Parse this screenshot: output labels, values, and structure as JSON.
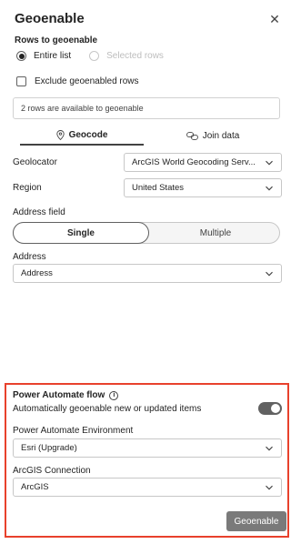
{
  "header": {
    "title": "Geoenable",
    "close_icon": "close-icon"
  },
  "rows_section": {
    "label": "Rows to geoenable",
    "options": [
      {
        "label": "Entire list",
        "checked": true,
        "disabled": false
      },
      {
        "label": "Selected rows",
        "checked": false,
        "disabled": true
      }
    ],
    "exclude_label": "Exclude geoenabled rows",
    "exclude_checked": false,
    "info_text": "2 rows are available to geoenable"
  },
  "tabs": [
    {
      "label": "Geocode",
      "icon": "location-pin-icon",
      "active": true
    },
    {
      "label": "Join data",
      "icon": "link-icon",
      "active": false
    }
  ],
  "fields": {
    "geolocator_label": "Geolocator",
    "geolocator_value": "ArcGIS World Geocoding Serv...",
    "region_label": "Region",
    "region_value": "United States",
    "address_field_label": "Address field",
    "segment_single": "Single",
    "segment_multiple": "Multiple",
    "segment_selected": "Single",
    "address_label": "Address",
    "address_value": "Address"
  },
  "power_automate": {
    "title": "Power Automate flow",
    "toggle_label": "Automatically geoenable new or updated items",
    "toggle_on": true,
    "environment_label": "Power Automate Environment",
    "environment_value": "Esri (Upgrade)",
    "connection_label": "ArcGIS Connection",
    "connection_value": "ArcGIS",
    "highlight_color": "#e8412c"
  },
  "actions": {
    "geoenable_button": "Geoenable"
  }
}
